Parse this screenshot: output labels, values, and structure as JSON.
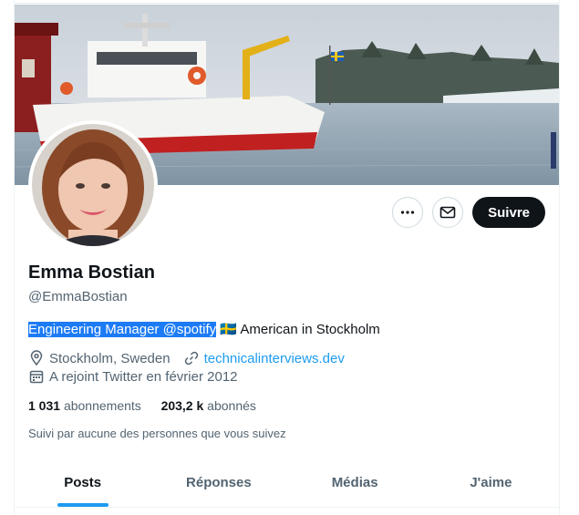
{
  "profile": {
    "name": "Emma Bostian",
    "handle": "@EmmaBostian",
    "bio_selected": "Engineering Manager @spotify",
    "bio_flag": "🇸🇪",
    "bio_rest": " American in Stockholm",
    "location": "Stockholm, Sweden",
    "website": "technicalinterviews.dev",
    "joined": "A rejoint Twitter en février 2012",
    "following_count": "1 031",
    "following_label": "abonnements",
    "followers_count": "203,2 k",
    "followers_label": "abonnés",
    "followed_by": "Suivi par aucune des personnes que vous suivez"
  },
  "actions": {
    "more_icon": "more-icon",
    "message_icon": "mail-icon",
    "follow_label": "Suivre"
  },
  "tabs": [
    {
      "label": "Posts",
      "active": true
    },
    {
      "label": "Réponses",
      "active": false
    },
    {
      "label": "Médias",
      "active": false
    },
    {
      "label": "J'aime",
      "active": false
    }
  ],
  "colors": {
    "accent": "#1d9bf0",
    "text": "#0f1419",
    "secondary": "#536471",
    "selection": "#1d7bf5"
  }
}
